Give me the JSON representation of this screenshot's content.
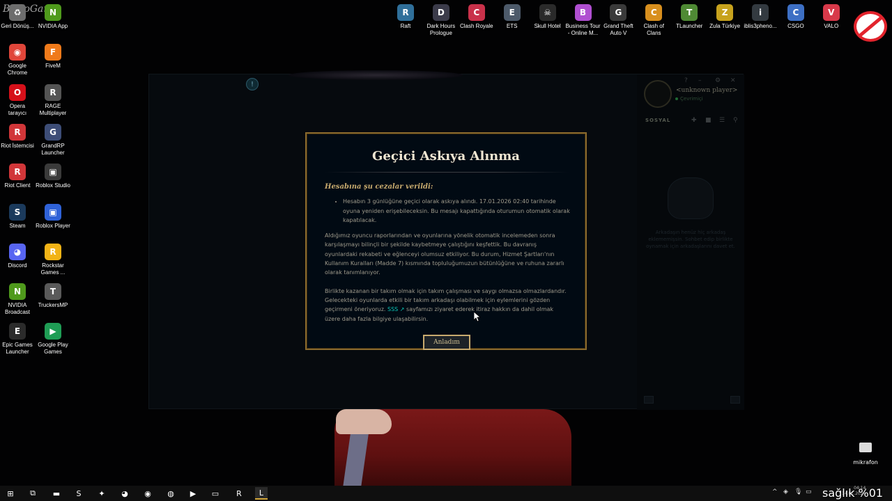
{
  "watermark": "ByNoGame",
  "desktop_left": [
    {
      "label": "Geri Dönüş...",
      "icon": "recycle-bin-icon",
      "color": "#6d6d6d",
      "glyph": "♻"
    },
    {
      "label": "NVIDIA App",
      "icon": "nvidia-icon",
      "color": "#4f9a1c",
      "glyph": "N"
    },
    {
      "label": "Google Chrome",
      "icon": "chrome-icon",
      "color": "#e0463a",
      "glyph": "◉"
    },
    {
      "label": "FiveM",
      "icon": "fivem-icon",
      "color": "#f07a1a",
      "glyph": "F"
    },
    {
      "label": "Opera tarayıcı",
      "icon": "opera-icon",
      "color": "#d6101a",
      "glyph": "O"
    },
    {
      "label": "RAGE Multiplayer",
      "icon": "rage-icon",
      "color": "#545454",
      "glyph": "R"
    },
    {
      "label": "Riot İstemcisi",
      "icon": "riot-client-icon",
      "color": "#d13639",
      "glyph": "R"
    },
    {
      "label": "GrandRP Launcher",
      "icon": "grandrp-icon",
      "color": "#3d4d77",
      "glyph": "G"
    },
    {
      "label": "Riot Client",
      "icon": "riot-client-icon",
      "color": "#d13639",
      "glyph": "R"
    },
    {
      "label": "Roblox Studio",
      "icon": "roblox-studio-icon",
      "color": "#3a3a3a",
      "glyph": "▣"
    },
    {
      "label": "Steam",
      "icon": "steam-icon",
      "color": "#1b3a5c",
      "glyph": "S"
    },
    {
      "label": "Roblox Player",
      "icon": "roblox-player-icon",
      "color": "#2f62d8",
      "glyph": "▣"
    },
    {
      "label": "Discord",
      "icon": "discord-icon",
      "color": "#5865f2",
      "glyph": "◕"
    },
    {
      "label": "Rockstar Games ...",
      "icon": "rockstar-icon",
      "color": "#f2b316",
      "glyph": "R"
    },
    {
      "label": "NVIDIA Broadcast",
      "icon": "nvidia-broadcast-icon",
      "color": "#4f9a1c",
      "glyph": "N"
    },
    {
      "label": "TruckersMP",
      "icon": "truckersmp-icon",
      "color": "#5a5a5a",
      "glyph": "T"
    },
    {
      "label": "Epic Games Launcher",
      "icon": "epic-games-icon",
      "color": "#2b2b2b",
      "glyph": "E"
    },
    {
      "label": "Google Play Games",
      "icon": "google-play-games-icon",
      "color": "#1f9d55",
      "glyph": "▶"
    }
  ],
  "desktop_top": [
    {
      "label": "Raft",
      "icon": "raft-icon",
      "color": "#2f6f9a",
      "glyph": "R"
    },
    {
      "label": "Dark Hours Prologue",
      "icon": "dark-hours-icon",
      "color": "#3b3b4a",
      "glyph": "D"
    },
    {
      "label": "Clash Royale",
      "icon": "clash-royale-icon",
      "color": "#c9314a",
      "glyph": "C"
    },
    {
      "label": "ETS",
      "icon": "ets-icon",
      "color": "#4d5a6a",
      "glyph": "E"
    },
    {
      "label": "Skull Hotel",
      "icon": "skull-hotel-icon",
      "color": "#2a2a2a",
      "glyph": "☠"
    },
    {
      "label": "Business Tour - Online M...",
      "icon": "business-tour-icon",
      "color": "#b04fd1",
      "glyph": "B"
    },
    {
      "label": "Grand Theft Auto V",
      "icon": "gta-v-icon",
      "color": "#3a3a3a",
      "glyph": "G"
    },
    {
      "label": "Clash of Clans",
      "icon": "clash-of-clans-icon",
      "color": "#d88f1e",
      "glyph": "C"
    },
    {
      "label": "TLauncher",
      "icon": "tlauncher-icon",
      "color": "#4f8a34",
      "glyph": "T"
    },
    {
      "label": "Zula Türkiye",
      "icon": "zula-icon",
      "color": "#c7a21d",
      "glyph": "Z"
    },
    {
      "label": "iblis3pheno...",
      "icon": "game-icon",
      "color": "#333a40",
      "glyph": "i"
    },
    {
      "label": "CSGO",
      "icon": "csgo-icon",
      "color": "#3d6fc4",
      "glyph": "C"
    },
    {
      "label": "VALO",
      "icon": "valorant-icon",
      "color": "#d8394a",
      "glyph": "V"
    }
  ],
  "client": {
    "player_name": "<unknown player>",
    "player_status": "Çevrimiçi",
    "social_title": "SOSYAL",
    "empty_text": "Arkadaşın henüz hiç arkadaş eklememişsin. Sohbet edip birlikte oynamak için arkadaşlarını davet et.",
    "controls": [
      "?",
      "–",
      "⚙",
      "✕"
    ]
  },
  "modal": {
    "title": "Geçici Askıya Alınma",
    "subhead": "Hesabına şu cezalar verildi:",
    "bullet": "Hesabın 3 günlüğüne geçici olarak askıya alındı. 17.01.2026 02:40 tarihinde oyuna yeniden erişebileceksin. Bu mesajı kapattığında oturumun otomatik olarak kapatılacak.",
    "para1": "Aldığımız oyuncu raporlarından ve oyunlarına yönelik otomatik incelemeden sonra karşılaşmayı bilinçli bir şekilde kaybetmeye çalıştığını keşfettik. Bu davranış oyunlardaki rekabeti ve eğlenceyi olumsuz etkiliyor. Bu durum, Hizmet Şartları'nın Kullanım Kuralları (Madde 7) kısmında topluluğumuzun bütünlüğüne ve ruhuna zararlı olarak tanımlanıyor.",
    "para2_before": "Birlikte kazanan bir takım olmak için takım çalışması ve saygı olmazsa olmazlardandır. Gelecekteki oyunlarda etkili bir takım arkadaşı olabilmek için eylemlerini gözden geçirmeni öneriyoruz. ",
    "link": "SSS ↗",
    "para2_after": " sayfamızı ziyaret ederek itiraz hakkın da dahil olmak üzere daha fazla bilgiye ulaşabilirsin.",
    "button": "Anladım"
  },
  "overlay": {
    "mic_label": "mikrafon",
    "health_text": "sağlık %01"
  },
  "taskbar": {
    "apps": [
      {
        "name": "start-button",
        "glyph": "⊞"
      },
      {
        "name": "task-view-icon",
        "glyph": "⧉"
      },
      {
        "name": "file-explorer-icon",
        "glyph": "▬"
      },
      {
        "name": "steam-taskbar-icon",
        "glyph": "S"
      },
      {
        "name": "copilot-icon",
        "glyph": "✦"
      },
      {
        "name": "discord-taskbar-icon",
        "glyph": "◕"
      },
      {
        "name": "chrome-taskbar-icon",
        "glyph": "◉"
      },
      {
        "name": "gpu-tool-icon",
        "glyph": "◍"
      },
      {
        "name": "google-play-taskbar-icon",
        "glyph": "▶"
      },
      {
        "name": "terminal-icon",
        "glyph": "▭"
      },
      {
        "name": "riot-taskbar-icon",
        "glyph": "R"
      },
      {
        "name": "league-taskbar-icon",
        "glyph": "L"
      }
    ],
    "clock_time": "04:14",
    "clock_date": "14.01.2026"
  }
}
